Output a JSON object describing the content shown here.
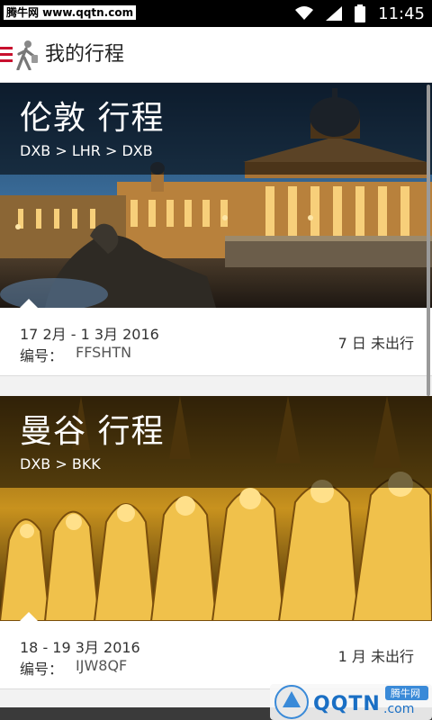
{
  "statusbar": {
    "watermark": "腾牛网 www.qqtn.com",
    "time": "11:45"
  },
  "header": {
    "title": "我的行程"
  },
  "trips": [
    {
      "city": "伦敦 行程",
      "route": "DXB > LHR > DXB",
      "dates": "17 2月 - 1 3月 2016",
      "ref_label": "编号：",
      "ref_value": "FFSHTN",
      "status": "7 日 未出行"
    },
    {
      "city": "曼谷 行程",
      "route": "DXB > BKK",
      "dates": "18 - 19 3月 2016",
      "ref_label": "编号：",
      "ref_value": "IJW8QF",
      "status": "1 月 未出行"
    }
  ],
  "badge": {
    "site": "QQTN",
    "suffix": ".com",
    "tag": "腾牛网"
  },
  "colors": {
    "accent": "#c8102e",
    "status_bar": "#000000"
  }
}
